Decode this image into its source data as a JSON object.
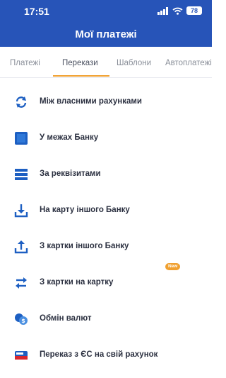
{
  "status_bar": {
    "time": "17:51",
    "battery": "78"
  },
  "header": {
    "title": "Мої платежі"
  },
  "tabs": [
    {
      "label": "Платежі",
      "active": false
    },
    {
      "label": "Перекази",
      "active": true
    },
    {
      "label": "Шаблони",
      "active": false
    },
    {
      "label": "Автоплатежі",
      "active": false
    }
  ],
  "transfers": [
    {
      "label": "Між власними рахунками",
      "icon": "refresh-icon"
    },
    {
      "label": "У межах Банку",
      "icon": "bank-square-icon"
    },
    {
      "label": "За реквізитами",
      "icon": "details-lines-icon"
    },
    {
      "label": "На карту іншого Банку",
      "icon": "tray-download-icon"
    },
    {
      "label": "З картки іншого Банку",
      "icon": "tray-upload-icon"
    },
    {
      "label": "З картки на картку",
      "icon": "swap-arrows-icon"
    },
    {
      "label": "Обмін валют",
      "icon": "currency-exchange-icon"
    },
    {
      "label": "Переказ з ЄС на свій рахунок",
      "icon": "eu-card-icon",
      "badge": "New"
    }
  ],
  "colors": {
    "brand": "#2754b8",
    "accent": "#f0a030",
    "icon_blue": "#1d5fc2",
    "text": "#2b3040",
    "tab_inactive": "#8a8f99"
  }
}
